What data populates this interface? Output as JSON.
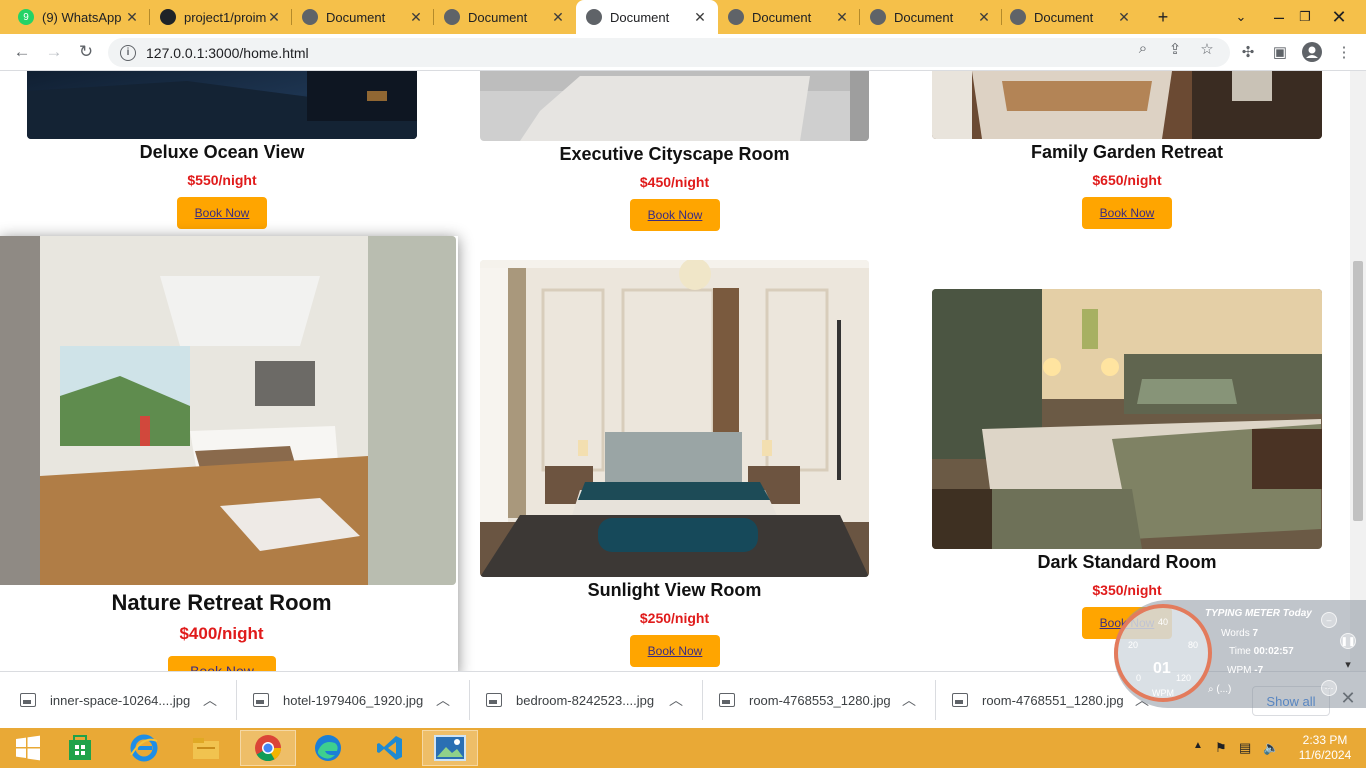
{
  "browser": {
    "tabs": [
      {
        "title": "(9) WhatsApp",
        "icon": "whatsapp-icon",
        "badge": "9"
      },
      {
        "title": "project1/proim",
        "icon": "github-icon"
      },
      {
        "title": "Document",
        "icon": "globe-icon"
      },
      {
        "title": "Document",
        "icon": "globe-icon"
      },
      {
        "title": "Document",
        "icon": "globe-icon",
        "active": true
      },
      {
        "title": "Document",
        "icon": "globe-icon"
      },
      {
        "title": "Document",
        "icon": "globe-icon"
      },
      {
        "title": "Document",
        "icon": "globe-icon"
      }
    ],
    "url": "127.0.0.1:3000/home.html"
  },
  "rooms": [
    {
      "name": "Deluxe Ocean View",
      "price": "$550/night",
      "button": "Book Now"
    },
    {
      "name": "Executive Cityscape Room",
      "price": "$450/night",
      "button": "Book Now"
    },
    {
      "name": "Family Garden Retreat",
      "price": "$650/night",
      "button": "Book Now"
    },
    {
      "name": "Nature Retreat Room",
      "price": "$400/night",
      "button": "Book Now"
    },
    {
      "name": "Sunlight View Room",
      "price": "$250/night",
      "button": "Book Now"
    },
    {
      "name": "Dark Standard Room",
      "price": "$350/night",
      "button": "Book Now"
    }
  ],
  "downloads": {
    "items": [
      "inner-space-10264....jpg",
      "hotel-1979406_1920.jpg",
      "bedroom-8242523....jpg",
      "room-4768553_1280.jpg",
      "room-4768551_1280.jpg"
    ],
    "show_all": "Show all"
  },
  "typing_meter": {
    "title": "TYPING METER Today",
    "words_label": "Words",
    "words_value": "7",
    "time_label": "Time",
    "time_value": "00:02:57",
    "wpm_label": "WPM",
    "wpm_value": "-7",
    "gauge_value": "01",
    "gauge_unit": "WPM",
    "gauge_ticks": [
      "40",
      "20",
      "80",
      "120",
      "0"
    ]
  },
  "taskbar": {
    "time": "2:33 PM",
    "date": "11/6/2024"
  },
  "colors": {
    "accent": "#ffa500",
    "price": "#e01b1b",
    "tabstrip": "#f5c04a",
    "taskbar": "#e9a936"
  }
}
